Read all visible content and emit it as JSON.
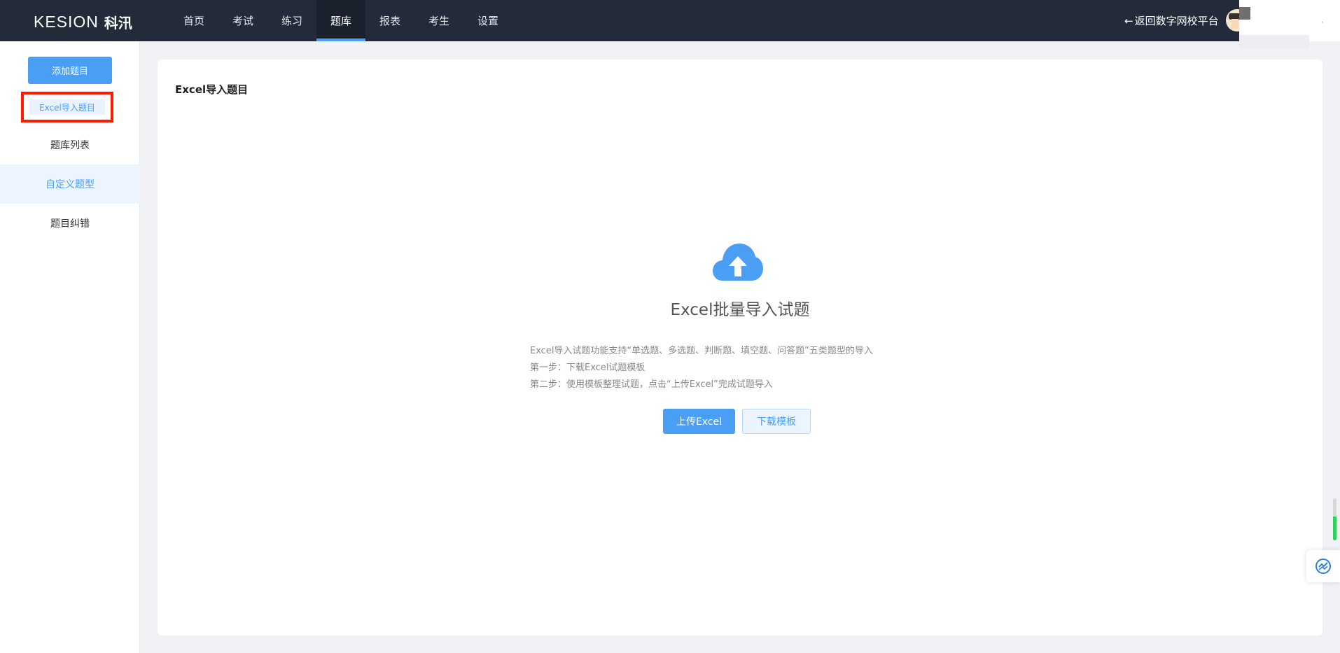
{
  "brand": {
    "logo_en": "KESION",
    "logo_cn": "科汛"
  },
  "nav": {
    "items": [
      {
        "label": "首页"
      },
      {
        "label": "考试"
      },
      {
        "label": "练习"
      },
      {
        "label": "题库",
        "active": true
      },
      {
        "label": "报表"
      },
      {
        "label": "考生"
      },
      {
        "label": "设置"
      }
    ],
    "back_link": "返回数字网校平台"
  },
  "sidebar": {
    "add_button": "添加题目",
    "excel_item": "Excel导入题目",
    "items": [
      {
        "label": "题库列表"
      },
      {
        "label": "自定义题型"
      },
      {
        "label": "题目纠错"
      }
    ]
  },
  "main": {
    "title": "Excel导入题目",
    "upload_title": "Excel批量导入试题",
    "desc_lines": [
      "Excel导入试题功能支持“单选题、多选题、判断题、填空题、问答题”五类题型的导入",
      "第一步：下载Excel试题模板",
      "第二步：使用模板整理试题，点击“上传Excel”完成试题导入"
    ],
    "upload_button": "上传Excel",
    "template_button": "下载模板"
  },
  "colors": {
    "accent": "#4a9ff5",
    "topbar": "#232b3a",
    "highlight_border": "#ff1a00"
  },
  "icons": [
    "cloud-upload-icon",
    "arrow-left-icon",
    "sync-widget-icon"
  ]
}
